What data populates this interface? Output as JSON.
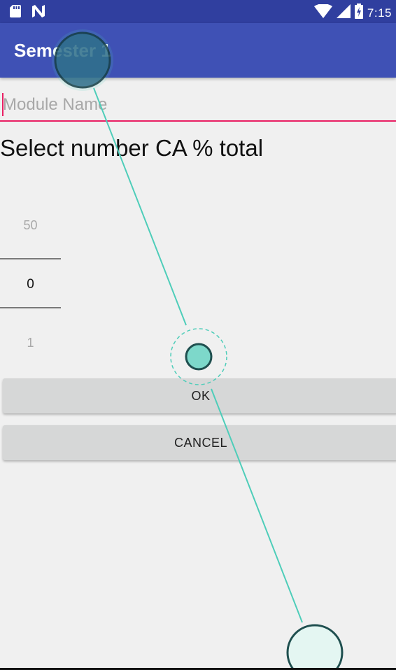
{
  "status_bar": {
    "time": "7:15",
    "left_icons": [
      "sd-card-icon",
      "n-notification-icon"
    ],
    "right_icons": [
      "wifi-icon",
      "cell-signal-icon",
      "battery-charging-icon"
    ]
  },
  "app_bar": {
    "title": "Semester 1"
  },
  "module_name": {
    "value": "",
    "placeholder": "Module Name"
  },
  "heading": "Select number CA % total",
  "number_picker": {
    "previous": "50",
    "current": "0",
    "next": "1"
  },
  "buttons": {
    "ok": "OK",
    "cancel": "CANCEL"
  },
  "colors": {
    "status_bar": "#303f9f",
    "app_bar": "#3f51b5",
    "accent": "#e91e63",
    "background": "#f0f0f0",
    "button": "#d6d7d7",
    "gesture": "#4ecdb9"
  }
}
